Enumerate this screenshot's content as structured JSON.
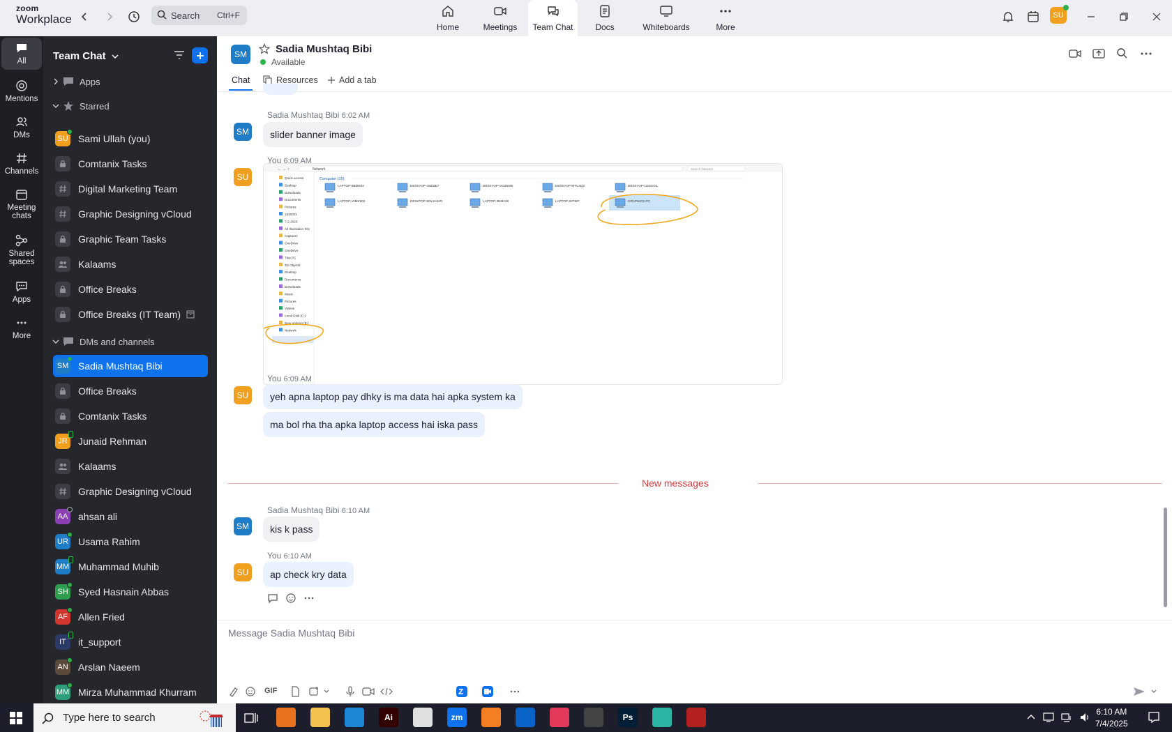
{
  "app": {
    "brand_top": "zoom",
    "brand_bottom": "Workplace"
  },
  "search": {
    "placeholder": "Search",
    "shortcut": "Ctrl+F"
  },
  "top_tabs": [
    {
      "label": "Home",
      "icon": "home-icon"
    },
    {
      "label": "Meetings",
      "icon": "video-icon"
    },
    {
      "label": "Team Chat",
      "icon": "chat-icon",
      "active": true
    },
    {
      "label": "Docs",
      "icon": "docs-icon"
    },
    {
      "label": "Whiteboards",
      "icon": "whiteboard-icon"
    },
    {
      "label": "More",
      "icon": "more-icon"
    }
  ],
  "user": {
    "initials": "SU"
  },
  "rail": [
    {
      "label": "All",
      "icon": "chat-bubble-icon",
      "active": true
    },
    {
      "label": "Mentions",
      "icon": "at-icon"
    },
    {
      "label": "DMs",
      "icon": "people-icon"
    },
    {
      "label": "Channels",
      "icon": "hash-icon"
    },
    {
      "label": "Meeting chats",
      "icon": "calendar-icon"
    },
    {
      "label": "Shared spaces",
      "icon": "shared-icon"
    },
    {
      "label": "Apps",
      "icon": "apps-icon"
    },
    {
      "label": "More",
      "icon": "more-icon"
    }
  ],
  "sidebar": {
    "title": "Team Chat",
    "sections": {
      "apps": "Apps",
      "starred": "Starred",
      "dms": "DMs and channels"
    },
    "starred": [
      {
        "label": "Sami Ullah (you)",
        "type": "avatar",
        "initials": "SU",
        "color": "#f0a01e",
        "status": "online"
      },
      {
        "label": "Comtanix Tasks",
        "type": "lock"
      },
      {
        "label": "Digital Marketing Team",
        "type": "hash"
      },
      {
        "label": "Graphic Designing vCloud",
        "type": "hash"
      },
      {
        "label": "Graphic Team Tasks",
        "type": "lock"
      },
      {
        "label": "Kalaams",
        "type": "group"
      },
      {
        "label": "Office Breaks",
        "type": "lock"
      },
      {
        "label": "Office Breaks (IT Team)",
        "type": "lock",
        "archived": true
      }
    ],
    "dms": [
      {
        "label": "Sadia Mushtaq Bibi",
        "type": "avatar",
        "initials": "SM",
        "color": "#1f7cc7",
        "status": "online",
        "active": true
      },
      {
        "label": "Office Breaks",
        "type": "lock"
      },
      {
        "label": "Comtanix Tasks",
        "type": "lock"
      },
      {
        "label": "Junaid Rehman",
        "type": "avatar",
        "initials": "JR",
        "color": "#f0a01e",
        "status": "phone"
      },
      {
        "label": "Kalaams",
        "type": "group"
      },
      {
        "label": "Graphic Designing vCloud",
        "type": "hash"
      },
      {
        "label": "ahsan ali",
        "type": "avatar",
        "initials": "AA",
        "color": "#8b3fb5",
        "status": "offline"
      },
      {
        "label": "Usama Rahim",
        "type": "avatar",
        "initials": "UR",
        "color": "#1f7cc7",
        "status": "online"
      },
      {
        "label": "Muhammad Muhib",
        "type": "avatar",
        "initials": "MM",
        "color": "#1f7cc7",
        "status": "phone"
      },
      {
        "label": "Syed Hasnain Abbas",
        "type": "avatar",
        "initials": "SH",
        "color": "#2e9e4e",
        "status": "online"
      },
      {
        "label": "Allen Fried",
        "type": "avatar",
        "initials": "AF",
        "color": "#d2362f",
        "status": "online"
      },
      {
        "label": "it_support",
        "type": "avatar",
        "initials": "IT",
        "color": "#2b3a67",
        "status": "phone"
      },
      {
        "label": "Arslan Naeem",
        "type": "avatar",
        "initials": "AN",
        "color": "#5a4a3a",
        "status": "online"
      },
      {
        "label": "Mirza Muhammad Khurram",
        "type": "avatar",
        "initials": "MM",
        "color": "#2e9e7a",
        "status": "online"
      }
    ]
  },
  "conversation": {
    "initials": "SM",
    "name": "Sadia Mushtaq Bibi",
    "status": "Available",
    "tabs": {
      "chat": "Chat",
      "resources": "Resources",
      "add": "Add a tab"
    }
  },
  "messages": {
    "m1": {
      "sender": "Sadia Mushtaq Bibi",
      "time": "6:02 AM",
      "text": "slider banner image",
      "initials": "SM"
    },
    "m2": {
      "sender": "You",
      "time": "6:09 AM",
      "initials": "SU"
    },
    "m3": {
      "sender": "You",
      "time": "6:09 AM",
      "initials": "SU",
      "lines": [
        "yeh apna laptop pay dhky is ma data hai apka system ka",
        "ma bol rha tha apka laptop access hai iska pass"
      ]
    },
    "m4": {
      "sender": "Sadia Mushtaq Bibi",
      "time": "6:10 AM",
      "text": "kis k pass",
      "initials": "SM"
    },
    "m5": {
      "sender": "You",
      "time": "6:10 AM",
      "text": "ap check kry data",
      "initials": "SU"
    },
    "new_messages": "New messages"
  },
  "attachment": {
    "breadcrumb": "Network",
    "search_placeholder": "Search Network",
    "group_header": "Computer (10)",
    "computers": [
      "LAPTOP-BBMS03",
      "DESKTOP-4S8IZE7",
      "DESKTOP-OO3N0W",
      "DESKTOP-MTU4Q2",
      "DESKTOP-1SS2AAL",
      "LAPTOP-12MK502",
      "DESKTOP-9OL2A0JO",
      "LAPTOP-3NI8128",
      "LAPTOP-22T6IP",
      "GRAPHICS-PC"
    ],
    "nav": [
      "Quick access",
      "Desktop",
      "Downloads",
      "Documents",
      "Pictures",
      "1820001",
      "7-2-2025",
      "All Illustration File",
      "Captures",
      "OneDrive",
      "OneDrive",
      "This PC",
      "3D Objects",
      "Desktop",
      "Documents",
      "Downloads",
      "Music",
      "Pictures",
      "Videos",
      "Local Disk (C:)",
      "New Volume (E:)",
      "Network"
    ]
  },
  "compose": {
    "placeholder": "Message Sadia Mushtaq Bibi",
    "gif": "GIF"
  },
  "taskbar": {
    "search": "Type here to search",
    "time": "6:10 AM",
    "date": "7/4/2025",
    "apps": [
      {
        "icon": "firefox-icon",
        "color": "#e8731f",
        "label": ""
      },
      {
        "icon": "file-explorer-icon",
        "color": "#f2c14e",
        "label": ""
      },
      {
        "icon": "vscode-icon",
        "color": "#1e86d6",
        "label": ""
      },
      {
        "icon": "illustrator-icon",
        "color": "#330000",
        "label": "Ai"
      },
      {
        "icon": "chrome-icon",
        "color": "#e0e0e0",
        "label": ""
      },
      {
        "icon": "zoom-icon",
        "color": "#0e72ed",
        "label": "zm"
      },
      {
        "icon": "xampp-icon",
        "color": "#f57e22",
        "label": ""
      },
      {
        "icon": "outlook-icon",
        "color": "#0a64c8",
        "label": ""
      },
      {
        "icon": "creative-cloud-icon",
        "color": "#e33a5b",
        "label": ""
      },
      {
        "icon": "pen-tool-icon",
        "color": "#444",
        "label": ""
      },
      {
        "icon": "photoshop-icon",
        "color": "#001e36",
        "label": "Ps"
      },
      {
        "icon": "app-icon",
        "color": "#2bb3a3",
        "label": ""
      },
      {
        "icon": "filezilla-icon",
        "color": "#b52020",
        "label": ""
      }
    ]
  }
}
